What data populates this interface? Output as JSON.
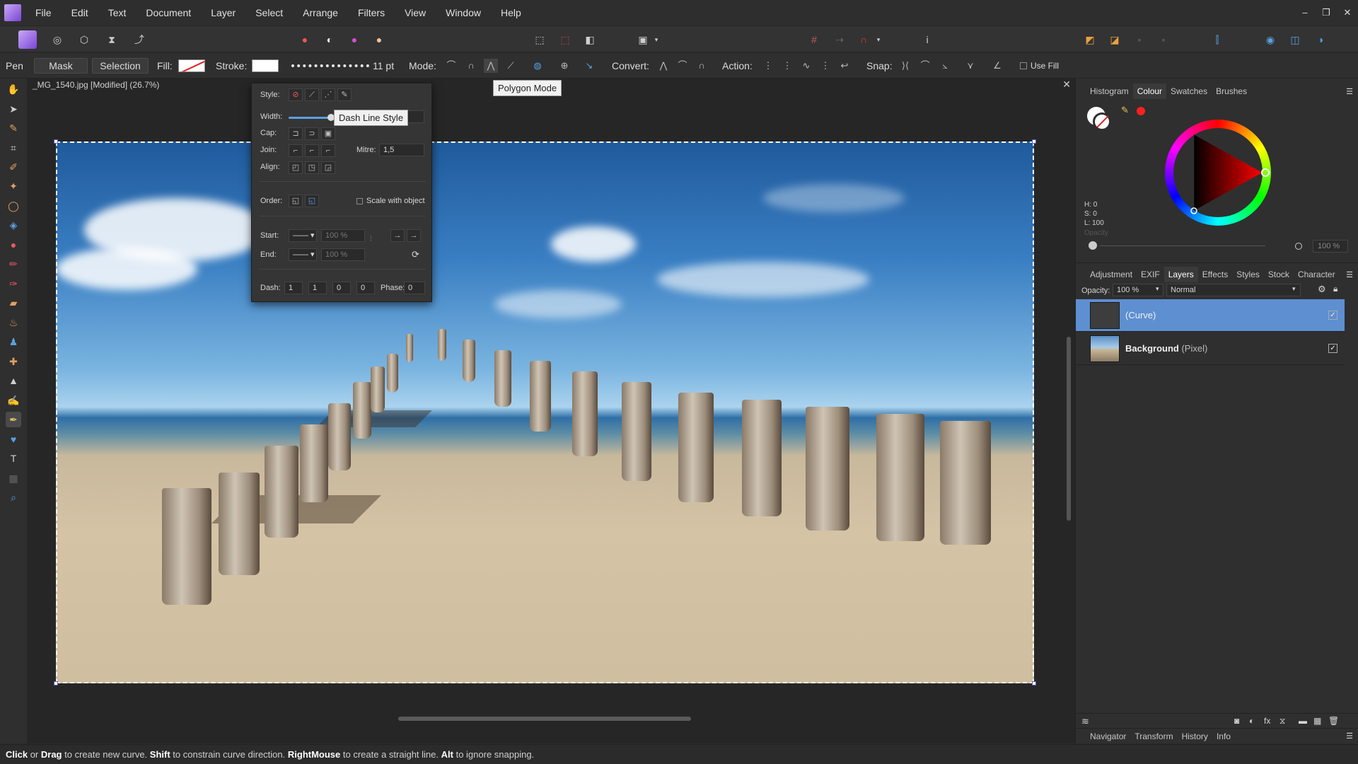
{
  "menu": [
    "File",
    "Edit",
    "Text",
    "Document",
    "Layer",
    "Select",
    "Arrange",
    "Filters",
    "View",
    "Window",
    "Help"
  ],
  "window_controls": [
    "–",
    "❐",
    "✕"
  ],
  "context": {
    "tool": "Pen",
    "mask": "Mask",
    "selection": "Selection",
    "fill": "Fill:",
    "stroke": "Stroke:",
    "width_value": "11 pt",
    "mode": "Mode:",
    "convert": "Convert:",
    "action": "Action:",
    "snap": "Snap:",
    "use_fill": "Use Fill"
  },
  "document": {
    "title": "_MG_1540.jpg [Modified] (26.7%)"
  },
  "stroke_panel": {
    "style": "Style:",
    "width": "Width:",
    "cap": "Cap:",
    "join": "Join:",
    "mitre_label": "Mitre:",
    "mitre_value": "1,5",
    "align": "Align:",
    "order": "Order:",
    "scale_with_object": "Scale with object",
    "start": "Start:",
    "end": "End:",
    "start_pct": "100 %",
    "end_pct": "100 %",
    "dash": "Dash:",
    "dash_values": [
      "1",
      "1",
      "0",
      "0"
    ],
    "phase": "Phase:",
    "phase_value": "0"
  },
  "tooltips": {
    "dash_line_style": "Dash Line Style",
    "polygon_mode": "Polygon Mode"
  },
  "color_panel": {
    "tabs": [
      "Histogram",
      "Colour",
      "Swatches",
      "Brushes"
    ],
    "active_tab": "Colour",
    "h": "H: 0",
    "s": "S: 0",
    "l": "L: 100",
    "opacity_label": "Opacity",
    "opacity_value": "100 %",
    "stroke_color": "#ff2020"
  },
  "layers_panel": {
    "tabs": [
      "Adjustment",
      "EXIF",
      "Layers",
      "Effects",
      "Styles",
      "Stock",
      "Character"
    ],
    "active_tab": "Layers",
    "opacity_label": "Opacity:",
    "opacity_value": "100 %",
    "blend_mode": "Normal",
    "layers": [
      {
        "name": "(Curve)",
        "type": "",
        "selected": true
      },
      {
        "name": "Background",
        "type": "(Pixel)",
        "selected": false
      }
    ]
  },
  "bottom_tabs": [
    "Navigator",
    "Transform",
    "History",
    "Info"
  ],
  "status": {
    "k1": "Click",
    "t1": " or ",
    "k2": "Drag",
    "t2": " to create new curve. ",
    "k3": "Shift",
    "t3": " to constrain curve direction. ",
    "k4": "RightMouse",
    "t4": " to create a straight line. ",
    "k5": "Alt",
    "t5": " to ignore snapping."
  }
}
